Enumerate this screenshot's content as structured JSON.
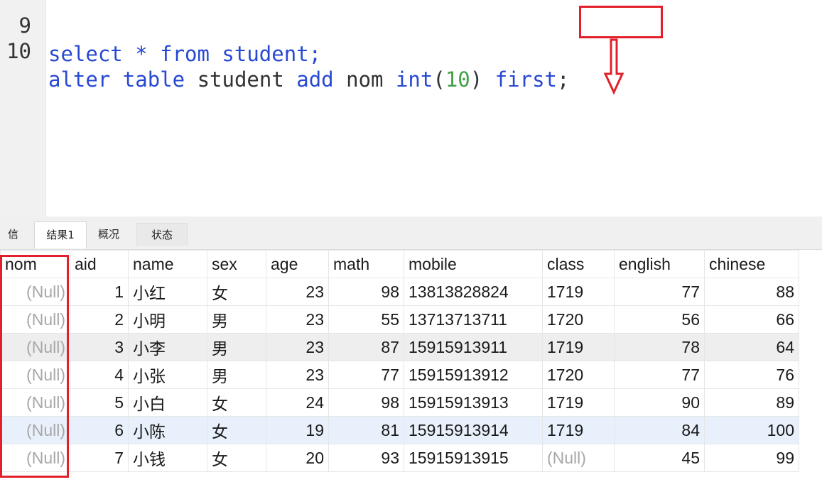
{
  "editor": {
    "lines": [
      {
        "number": "9",
        "text": "select * from student;"
      },
      {
        "number": "10",
        "tokens": {
          "t1": "alter",
          "t2": "table",
          "t3": "student",
          "t4": "add",
          "t5": "nom",
          "t6": "int",
          "t7": "(",
          "t8": "10",
          "t9": ")",
          "t10": "first",
          "t11": ";"
        }
      }
    ]
  },
  "tabs": [
    {
      "label": "信息"
    },
    {
      "label": "结果1",
      "active": true
    },
    {
      "label": "概况"
    },
    {
      "label": "状态"
    }
  ],
  "colors": {
    "highlight": "#e2202b",
    "keyword": "#2748d3",
    "number": "#43a047",
    "null_text": "#a8a8a8"
  },
  "grid": {
    "columns": [
      "nom",
      "aid",
      "name",
      "sex",
      "age",
      "math",
      "mobile",
      "class",
      "english",
      "chinese"
    ],
    "rows": [
      [
        "(Null)",
        "1",
        "小红",
        "女",
        "23",
        "98",
        "13813828824",
        "1719",
        "77",
        "88"
      ],
      [
        "(Null)",
        "2",
        "小明",
        "男",
        "23",
        "55",
        "13713713711",
        "1720",
        "56",
        "66"
      ],
      [
        "(Null)",
        "3",
        "小李",
        "男",
        "23",
        "87",
        "15915913911",
        "1719",
        "78",
        "64"
      ],
      [
        "(Null)",
        "4",
        "小张",
        "男",
        "23",
        "77",
        "15915913912",
        "1720",
        "77",
        "76"
      ],
      [
        "(Null)",
        "5",
        "小白",
        "女",
        "24",
        "98",
        "15915913913",
        "1719",
        "90",
        "89"
      ],
      [
        "(Null)",
        "6",
        "小陈",
        "女",
        "19",
        "81",
        "15915913914",
        "1719",
        "84",
        "100"
      ],
      [
        "(Null)",
        "7",
        "小钱",
        "女",
        "20",
        "93",
        "15915913915",
        "(Null)",
        "45",
        "99"
      ]
    ]
  }
}
